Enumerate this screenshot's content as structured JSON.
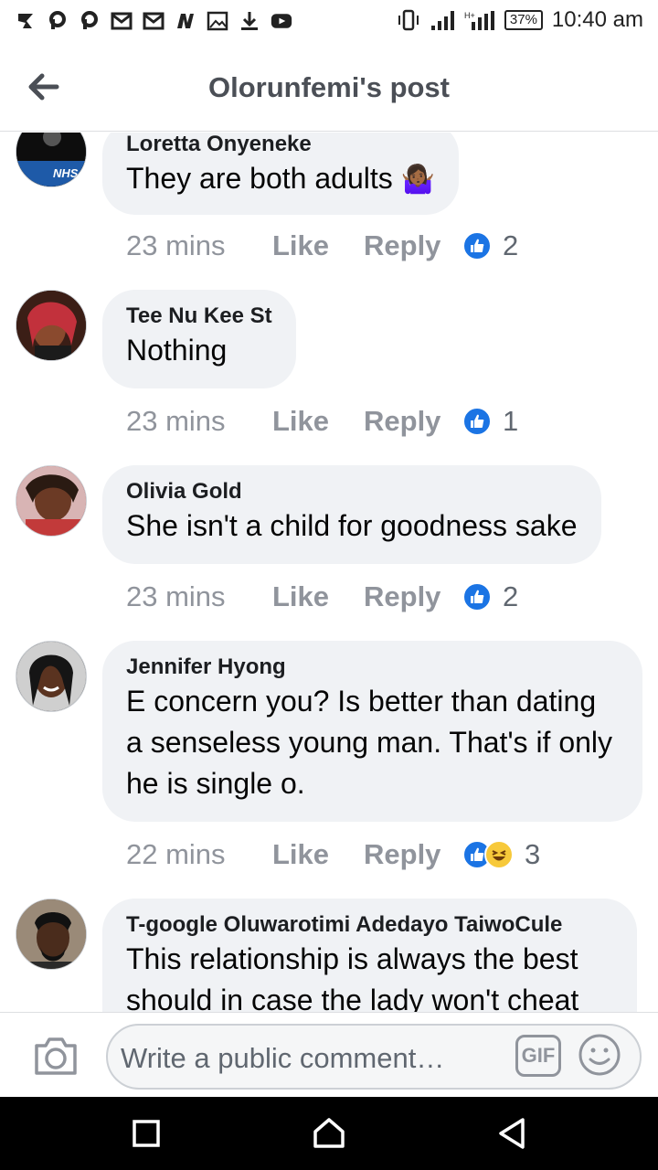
{
  "status_bar": {
    "time": "10:40 am",
    "battery": "37%"
  },
  "header": {
    "title": "Olorunfemi's post"
  },
  "comments": [
    {
      "name": "Loretta Onyeneke",
      "text": "They are both adults",
      "text_emoji": "🤷🏾‍♀️",
      "avatar_text": "NHS",
      "time": "23 mins",
      "like_label": "Like",
      "reply_label": "Reply",
      "reaction_count": "2",
      "reactions": [
        "like"
      ]
    },
    {
      "name": "Tee Nu Kee St",
      "text": "Nothing",
      "time": "23 mins",
      "like_label": "Like",
      "reply_label": "Reply",
      "reaction_count": "1",
      "reactions": [
        "like"
      ]
    },
    {
      "name": "Olivia Gold",
      "text": "She isn't a child for goodness sake",
      "time": "23 mins",
      "like_label": "Like",
      "reply_label": "Reply",
      "reaction_count": "2",
      "reactions": [
        "like"
      ]
    },
    {
      "name": "Jennifer Hyong",
      "text": "E concern you? Is better than dating a senseless young man. That's if only he is single o.",
      "time": "22 mins",
      "like_label": "Like",
      "reply_label": "Reply",
      "reaction_count": "3",
      "reactions": [
        "like",
        "haha"
      ]
    },
    {
      "name": "T-google Oluwarotimi Adedayo TaiwoCule",
      "text": "This relationship is always the best should in case the lady won't cheat"
    }
  ],
  "composer": {
    "placeholder": "Write a public comment…",
    "gif_label": "GIF"
  },
  "colors": {
    "brand_blue": "#1b74e4",
    "bubble_bg": "#f0f2f5",
    "meta_gray": "#90949c"
  }
}
